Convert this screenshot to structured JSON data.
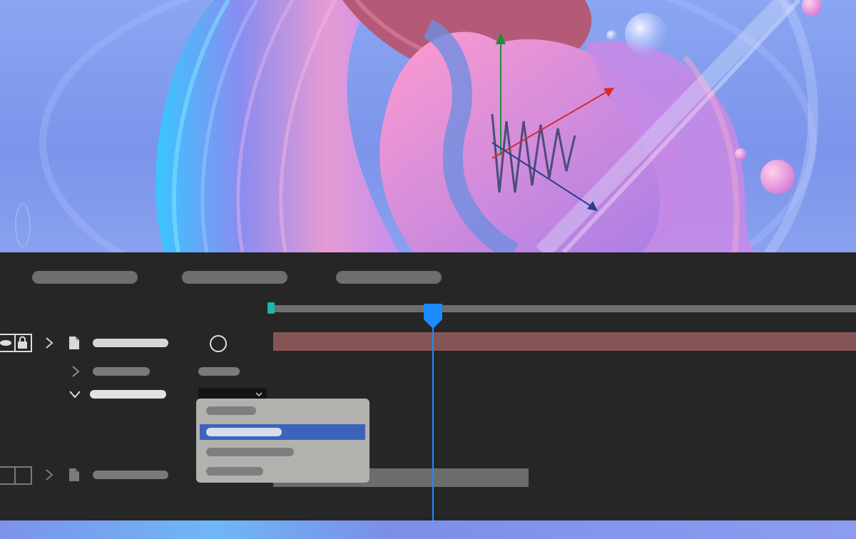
{
  "viewport": {
    "scene": "3d-abstract-render",
    "gizmo_axes": [
      "y-axis",
      "x-axis",
      "z-axis"
    ]
  },
  "toolbar": {
    "tabs": [
      {
        "label": ""
      },
      {
        "label": ""
      },
      {
        "label": ""
      }
    ]
  },
  "timeline": {
    "playhead_fraction": 0.28,
    "layers": [
      {
        "name": "",
        "expanded": false,
        "has_keyframe_circle": true
      },
      {
        "name": "",
        "property": "",
        "expanded": false
      },
      {
        "name": "",
        "expanded": true,
        "dropdown": {
          "selected": "",
          "options": [
            {
              "label": ""
            },
            {
              "label": "",
              "selected": true
            },
            {
              "label": ""
            },
            {
              "label": ""
            }
          ]
        }
      },
      {
        "name": "",
        "expanded": false
      }
    ]
  },
  "colors": {
    "panel_bg": "#262626",
    "accent_blue": "#1a8cff",
    "selection_blue": "#3c64bd",
    "layer_bar_red": "#855555",
    "start_marker_teal": "#19b8a8"
  }
}
